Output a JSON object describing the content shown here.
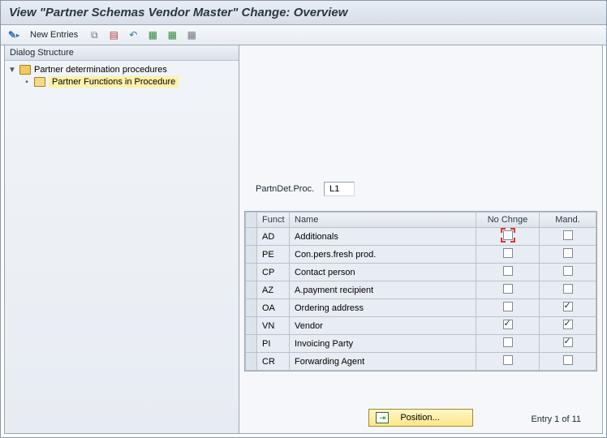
{
  "title": "View \"Partner Schemas Vendor Master\" Change: Overview",
  "toolbar": {
    "new_entries_label": "New Entries"
  },
  "tree": {
    "header": "Dialog Structure",
    "root_label": "Partner determination procedures",
    "child_label": "Partner Functions in Procedure"
  },
  "kv": {
    "label": "PartnDet.Proc.",
    "value": "L1"
  },
  "grid": {
    "headers": {
      "funct": "Funct",
      "name": "Name",
      "nochnge": "No Chnge",
      "mand": "Mand."
    },
    "rows": [
      {
        "funct": "AD",
        "name": "Additionals",
        "nochnge": false,
        "mand": false,
        "focus": true
      },
      {
        "funct": "PE",
        "name": "Con.pers.fresh prod.",
        "nochnge": false,
        "mand": false
      },
      {
        "funct": "CP",
        "name": "Contact person",
        "nochnge": false,
        "mand": false
      },
      {
        "funct": "AZ",
        "name": "A.payment recipient",
        "nochnge": false,
        "mand": false
      },
      {
        "funct": "OA",
        "name": "Ordering address",
        "nochnge": false,
        "mand": true
      },
      {
        "funct": "VN",
        "name": "Vendor",
        "nochnge": true,
        "mand": true
      },
      {
        "funct": "PI",
        "name": "Invoicing Party",
        "nochnge": false,
        "mand": true
      },
      {
        "funct": "CR",
        "name": "Forwarding Agent",
        "nochnge": false,
        "mand": false
      }
    ]
  },
  "footer": {
    "position_label": "Position...",
    "entry_label": "Entry 1 of 11"
  }
}
